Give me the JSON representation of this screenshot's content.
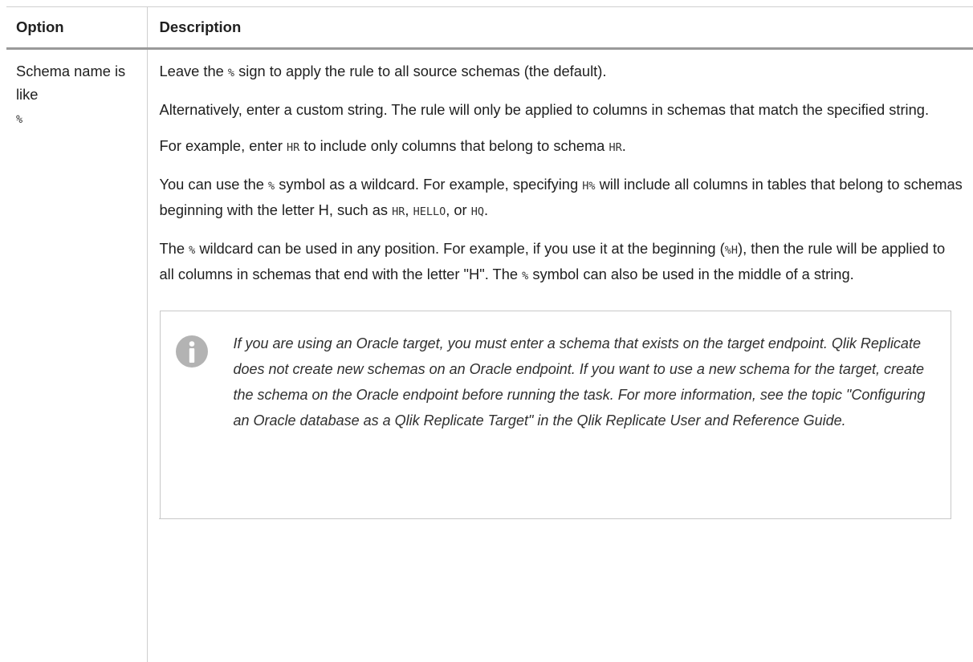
{
  "table": {
    "headers": {
      "option": "Option",
      "description": "Description"
    },
    "row": {
      "option_label": "Schema name is like",
      "option_value": "%",
      "paragraphs": [
        [
          {
            "t": "Leave the "
          },
          {
            "code": "%"
          },
          {
            "t": " sign to apply the rule to all source schemas (the default)."
          }
        ],
        [
          {
            "t": "Alternatively, enter a custom string. The rule will only be applied to columns in schemas that match the specified string."
          }
        ],
        [
          {
            "t": "For example, enter "
          },
          {
            "code": "HR"
          },
          {
            "t": " to include only columns that belong to schema "
          },
          {
            "code": "HR"
          },
          {
            "t": "."
          }
        ],
        [
          {
            "t": "You can use the "
          },
          {
            "code": "%"
          },
          {
            "t": " symbol as a wildcard. For example, specifying "
          },
          {
            "code": "H%"
          },
          {
            "t": " will include all columns in tables that belong to schemas beginning with the letter H, such as "
          },
          {
            "code": "HR"
          },
          {
            "t": ", "
          },
          {
            "code": "HELLO"
          },
          {
            "t": ", or "
          },
          {
            "code": "HQ"
          },
          {
            "t": "."
          }
        ],
        [
          {
            "t": "The "
          },
          {
            "code": "%"
          },
          {
            "t": " wildcard can be used in any position. For example, if you use it at the beginning ("
          },
          {
            "code": "%H"
          },
          {
            "t": "), then the rule will be applied to all columns in schemas that end with the letter \"H\". The "
          },
          {
            "code": "%"
          },
          {
            "t": " symbol can also be used in the middle of a string."
          }
        ]
      ],
      "note": {
        "icon": "info-icon",
        "text": "If you are using an Oracle target, you must enter a schema that exists on the target endpoint. Qlik Replicate does not create new schemas on an Oracle endpoint. If you want to use a new schema for the target, create the schema on the Oracle endpoint before running the task. For more information, see the topic \"Configuring an Oracle database as a Qlik Replicate Target\" in the Qlik Replicate User and Reference Guide."
      }
    }
  },
  "colors": {
    "icon_fill": "#b3b3b3",
    "note_border": "#c8c8c8",
    "header_rule": "#9a9a9a"
  }
}
